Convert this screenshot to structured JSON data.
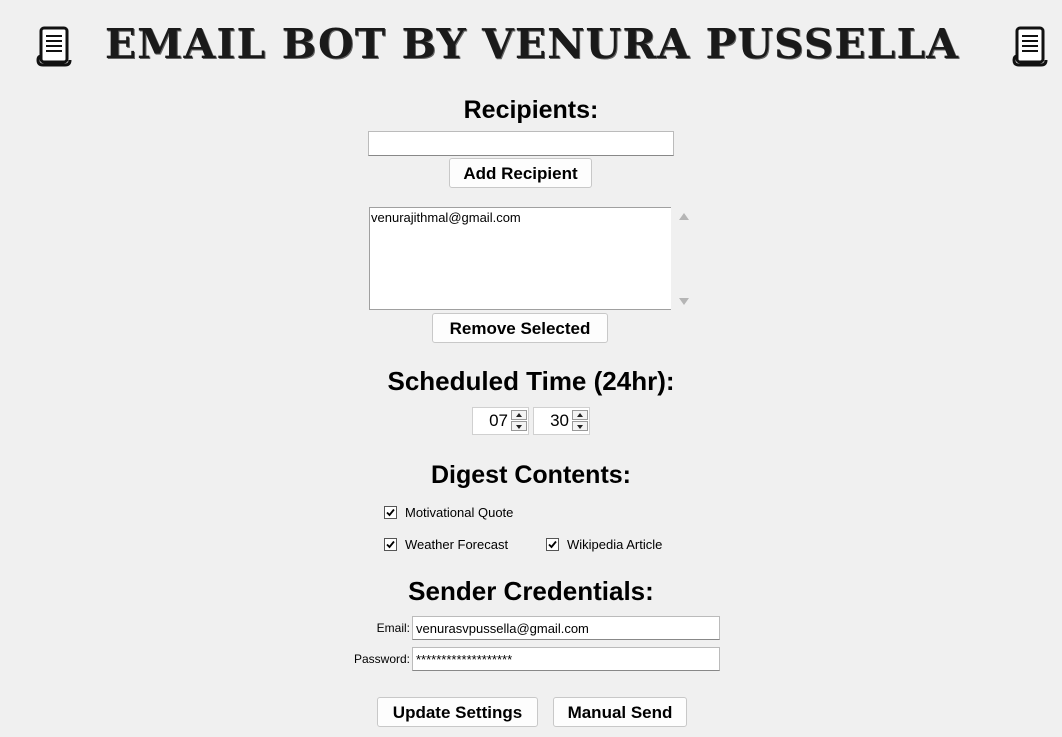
{
  "app": {
    "title": "Email Bot by Venura Pussella",
    "title_icon": "scroll-document-icon"
  },
  "recipients": {
    "heading": "Recipients:",
    "input_value": "",
    "add_button": "Add Recipient",
    "list": [
      "venurajithmal@gmail.com"
    ],
    "remove_button": "Remove Selected"
  },
  "schedule": {
    "heading": "Scheduled Time (24hr):",
    "hour": "07",
    "minute": "30"
  },
  "digest": {
    "heading": "Digest Contents:",
    "options": [
      {
        "label": "Motivational Quote",
        "checked": true
      },
      {
        "label": "Weather Forecast",
        "checked": true
      },
      {
        "label": "Wikipedia Article",
        "checked": true
      }
    ]
  },
  "credentials": {
    "heading": "Sender Credentials:",
    "email_label": "Email:",
    "email_value": "venurasvpussella@gmail.com",
    "password_label": "Password:",
    "password_value": "*******************"
  },
  "actions": {
    "update_button": "Update Settings",
    "send_button": "Manual Send"
  },
  "colors": {
    "background": "#f0f0f0",
    "title": "#1a1a1a"
  }
}
